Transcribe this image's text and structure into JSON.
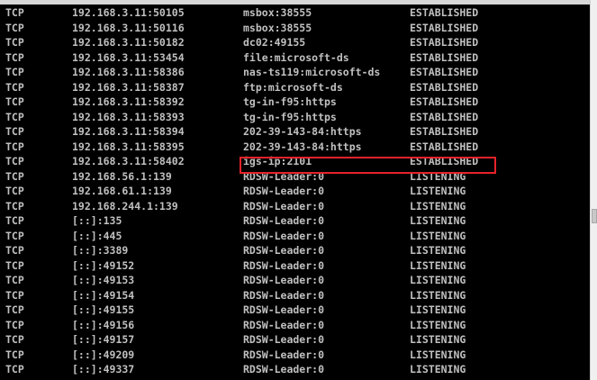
{
  "highlight_color": "#e8232a",
  "text_color": "#c0c0c0",
  "background_color": "#000000",
  "connections": [
    {
      "proto": "TCP",
      "local": "192.168.3.11:50105",
      "foreign": "msbox:38555",
      "state": "ESTABLISHED"
    },
    {
      "proto": "TCP",
      "local": "192.168.3.11:50116",
      "foreign": "msbox:38555",
      "state": "ESTABLISHED"
    },
    {
      "proto": "TCP",
      "local": "192.168.3.11:50182",
      "foreign": "dc02:49155",
      "state": "ESTABLISHED"
    },
    {
      "proto": "TCP",
      "local": "192.168.3.11:53454",
      "foreign": "file:microsoft-ds",
      "state": "ESTABLISHED"
    },
    {
      "proto": "TCP",
      "local": "192.168.3.11:58386",
      "foreign": "nas-ts119:microsoft-ds",
      "state": "ESTABLISHED"
    },
    {
      "proto": "TCP",
      "local": "192.168.3.11:58387",
      "foreign": "ftp:microsoft-ds",
      "state": "ESTABLISHED"
    },
    {
      "proto": "TCP",
      "local": "192.168.3.11:58392",
      "foreign": "tg-in-f95:https",
      "state": "ESTABLISHED"
    },
    {
      "proto": "TCP",
      "local": "192.168.3.11:58393",
      "foreign": "tg-in-f95:https",
      "state": "ESTABLISHED"
    },
    {
      "proto": "TCP",
      "local": "192.168.3.11:58394",
      "foreign": "202-39-143-84:https",
      "state": "ESTABLISHED"
    },
    {
      "proto": "TCP",
      "local": "192.168.3.11:58395",
      "foreign": "202-39-143-84:https",
      "state": "ESTABLISHED"
    },
    {
      "proto": "TCP",
      "local": "192.168.3.11:58402",
      "foreign": "igs-ip:2101",
      "state": "ESTABLISHED"
    },
    {
      "proto": "TCP",
      "local": "192.168.56.1:139",
      "foreign": "RDSW-Leader:0",
      "state": "LISTENING"
    },
    {
      "proto": "TCP",
      "local": "192.168.61.1:139",
      "foreign": "RDSW-Leader:0",
      "state": "LISTENING"
    },
    {
      "proto": "TCP",
      "local": "192.168.244.1:139",
      "foreign": "RDSW-Leader:0",
      "state": "LISTENING"
    },
    {
      "proto": "TCP",
      "local": "[::]:135",
      "foreign": "RDSW-Leader:0",
      "state": "LISTENING"
    },
    {
      "proto": "TCP",
      "local": "[::]:445",
      "foreign": "RDSW-Leader:0",
      "state": "LISTENING"
    },
    {
      "proto": "TCP",
      "local": "[::]:3389",
      "foreign": "RDSW-Leader:0",
      "state": "LISTENING"
    },
    {
      "proto": "TCP",
      "local": "[::]:49152",
      "foreign": "RDSW-Leader:0",
      "state": "LISTENING"
    },
    {
      "proto": "TCP",
      "local": "[::]:49153",
      "foreign": "RDSW-Leader:0",
      "state": "LISTENING"
    },
    {
      "proto": "TCP",
      "local": "[::]:49154",
      "foreign": "RDSW-Leader:0",
      "state": "LISTENING"
    },
    {
      "proto": "TCP",
      "local": "[::]:49155",
      "foreign": "RDSW-Leader:0",
      "state": "LISTENING"
    },
    {
      "proto": "TCP",
      "local": "[::]:49156",
      "foreign": "RDSW-Leader:0",
      "state": "LISTENING"
    },
    {
      "proto": "TCP",
      "local": "[::]:49157",
      "foreign": "RDSW-Leader:0",
      "state": "LISTENING"
    },
    {
      "proto": "TCP",
      "local": "[::]:49209",
      "foreign": "RDSW-Leader:0",
      "state": "LISTENING"
    },
    {
      "proto": "TCP",
      "local": "[::]:49337",
      "foreign": "RDSW-Leader:0",
      "state": "LISTENING"
    }
  ]
}
